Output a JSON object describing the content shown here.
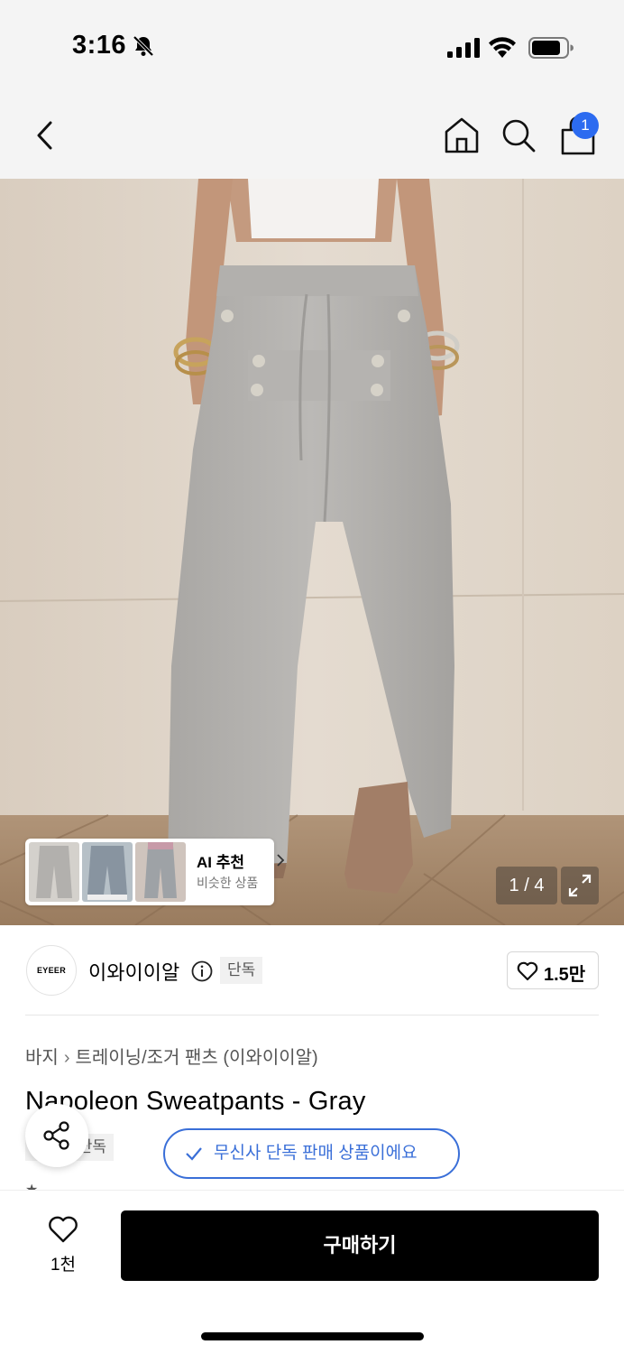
{
  "status_bar": {
    "time": "3:16",
    "icons": [
      "bell-off-icon",
      "cellular-signal-icon",
      "wifi-icon",
      "battery-icon"
    ]
  },
  "nav": {
    "icons": [
      "chevron-left-icon",
      "home-icon",
      "search-icon",
      "shopping-bag-icon"
    ],
    "cart_badge": "1"
  },
  "gallery": {
    "page_counter": "1 / 4",
    "ai_recommend": {
      "title": "AI 추천",
      "subtitle": "비슷한 상품"
    }
  },
  "brand": {
    "logo_text": "EYEER",
    "name": "이와이이알",
    "exclusive_tag": "단독",
    "like_count": "1.5만"
  },
  "product": {
    "breadcrumb": [
      "바지",
      "트레이닝/조거 팬츠 (이와이이알)"
    ],
    "title": "Napoleon Sweatpants - Gray",
    "tag": "단독",
    "exclusive_notice": "무신사 단독 판매 상품이에요"
  },
  "bottom_bar": {
    "wish_count": "1천",
    "buy_label": "구매하기"
  },
  "colors": {
    "accent_blue": "#3a6fd8",
    "badge_blue": "#2c6bf0",
    "buy_button": "#000000"
  }
}
